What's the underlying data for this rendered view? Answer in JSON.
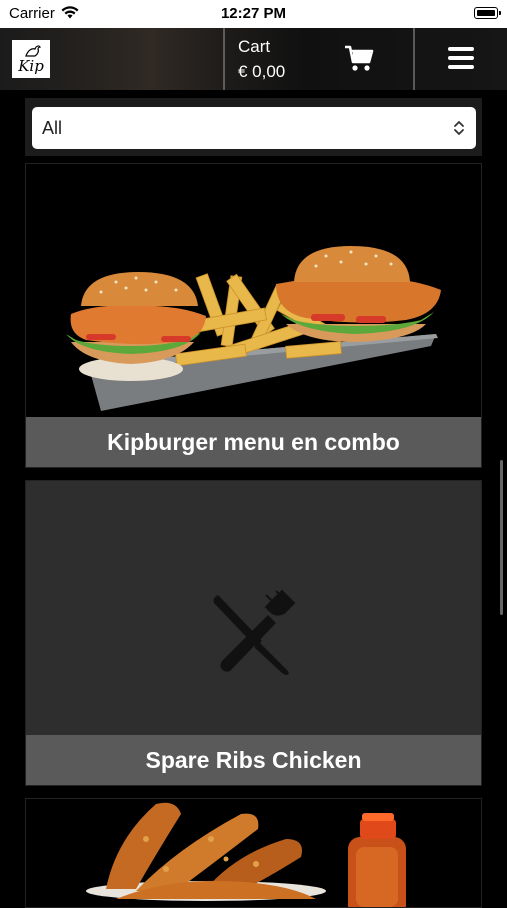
{
  "status_bar": {
    "carrier": "Carrier",
    "time": "12:27 PM"
  },
  "header": {
    "logo_text": "Kip",
    "cart_label": "Cart",
    "cart_total": "€ 0,00",
    "icons": [
      "cart-icon",
      "hamburger-menu-icon"
    ]
  },
  "filter": {
    "selected": "All"
  },
  "products": [
    {
      "name": "Kipburger menu en combo",
      "image": "burgers-and-fries-photo"
    },
    {
      "name": "Spare Ribs Chicken",
      "image": "fork-knife-placeholder-icon"
    },
    {
      "name": "",
      "image": "chicken-tenders-photo"
    }
  ],
  "colors": {
    "background": "#000000",
    "label_bar": "#5a5a5a",
    "placeholder_card": "#2e2e2e"
  }
}
